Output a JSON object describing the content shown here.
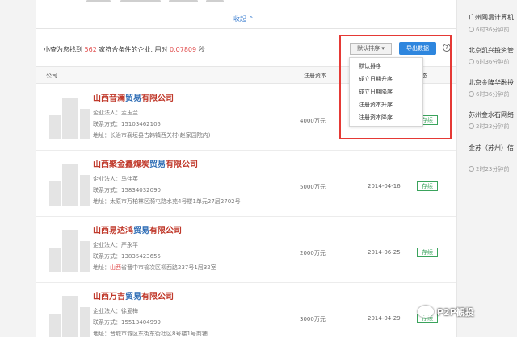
{
  "toolbar": {
    "collapse_label": "收起",
    "collapse_icon": "chevron-up-icon"
  },
  "summary": {
    "prefix": "小查为您找到",
    "count": "562",
    "middle": "家符合条件的企业, 用时",
    "time": "0.07809",
    "unit": "秒"
  },
  "actions": {
    "sort_label": "默认排序",
    "export_label": "导出数据",
    "help_label": "?"
  },
  "sort_menu": {
    "options": [
      "默认排序",
      "成立日期升序",
      "成立日期降序",
      "注册资本升序",
      "注册资本降序"
    ]
  },
  "table": {
    "headers": {
      "company": "公司",
      "capital": "注册资本",
      "status": "状态"
    },
    "rows": [
      {
        "name_pre": "山西音澜",
        "name_mid": "贸易",
        "name_post": "有限公司",
        "legal": "企业法人：孟玉兰",
        "phone": "联系方式：15103462105",
        "addr_pre": "地址：长治市襄垣县古韩镇西关村",
        "addr_hl": "",
        "addr_post": "(赵家园院内)",
        "capital": "4000万元",
        "date": "",
        "status": "存续"
      },
      {
        "name_pre": "山西聚金鑫煤炭",
        "name_mid": "贸易",
        "name_post": "有限公司",
        "legal": "企业法人：马伟英",
        "phone": "联系方式：15834032090",
        "addr_pre": "地址：太原市万柏林区漪屯路水苑4号楼1单元27层2702号",
        "addr_hl": "",
        "addr_post": "",
        "capital": "5000万元",
        "date": "2014-04-16",
        "status": "存续"
      },
      {
        "name_pre": "山西易达鸿",
        "name_mid": "贸易",
        "name_post": "有限公司",
        "legal": "企业法人：严永平",
        "phone": "联系方式：13835423655",
        "addr_pre": "地址：",
        "addr_hl": "山西",
        "addr_post": "省晋中市榆次区柳西路237号1层32室",
        "capital": "2000万元",
        "date": "2014-06-25",
        "status": "存续"
      },
      {
        "name_pre": "山西万吉",
        "name_mid": "贸易",
        "name_post": "有限公司",
        "legal": "企业法人：徐爱梅",
        "phone": "联系方式：15513404999",
        "addr_pre": "地址：晋城市城区东街东街社区8号楼1号商铺",
        "addr_hl": "",
        "addr_post": "",
        "capital": "3000万元",
        "date": "2014-04-29",
        "status": "存续"
      }
    ]
  },
  "sidebar": {
    "items": [
      {
        "title": "广州网易计算机",
        "time": "6时36分钟前"
      },
      {
        "title": "北京凯兴投资管",
        "time": "6时36分钟前"
      },
      {
        "title": "北京金隆华融投",
        "time": "6时36分钟前"
      },
      {
        "title": "苏州金水石网络",
        "time": "2时23分钟前"
      },
      {
        "title": "金苏（苏州）信",
        "time": "2时23分钟前"
      }
    ]
  },
  "watermark": {
    "text": "P2P観投"
  }
}
